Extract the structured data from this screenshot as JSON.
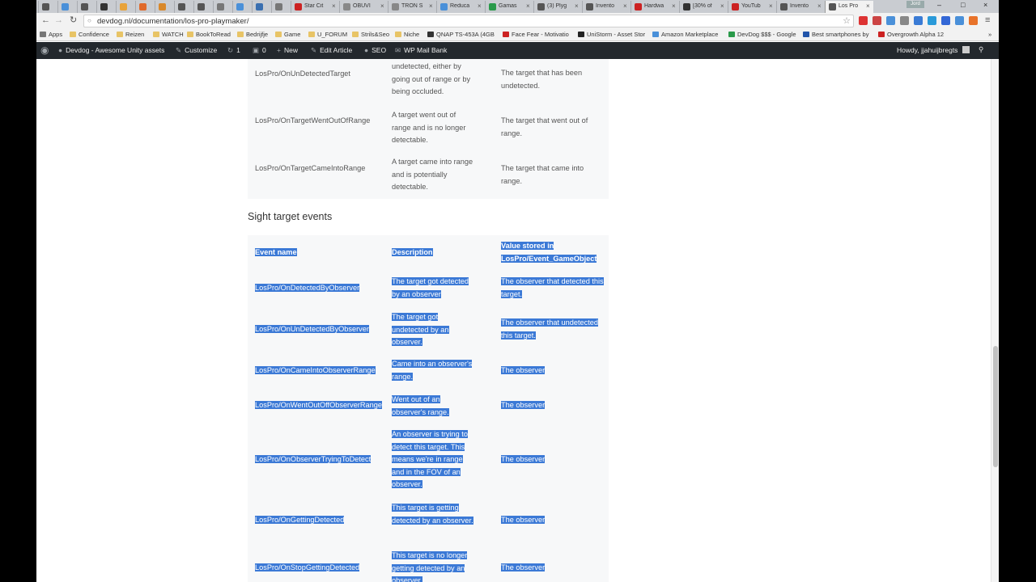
{
  "browser": {
    "tabs": [
      {
        "label": "",
        "color": "#555555"
      },
      {
        "label": "",
        "color": "#4a90d9"
      },
      {
        "label": "",
        "color": "#555555"
      },
      {
        "label": "",
        "color": "#333333"
      },
      {
        "label": "",
        "color": "#e8a33a"
      },
      {
        "label": "",
        "color": "#e06a2b"
      },
      {
        "label": "",
        "color": "#d9882a"
      },
      {
        "label": "",
        "color": "#555555"
      },
      {
        "label": "",
        "color": "#555555"
      },
      {
        "label": "",
        "color": "#777777"
      },
      {
        "label": "",
        "color": "#4a90d9"
      },
      {
        "label": "",
        "color": "#3a6fb0"
      },
      {
        "label": "",
        "color": "#777777"
      },
      {
        "label": "Star Cit",
        "color": "#cc2222"
      },
      {
        "label": "OBUVI",
        "color": "#888888"
      },
      {
        "label": "TRON S",
        "color": "#888888"
      },
      {
        "label": "Reduca",
        "color": "#4a90d9"
      },
      {
        "label": "Gamas",
        "color": "#2a9a4a"
      },
      {
        "label": "(3) Plyg",
        "color": "#555555"
      },
      {
        "label": "Invento",
        "color": "#555555"
      },
      {
        "label": "Hardwa",
        "color": "#cc2222"
      },
      {
        "label": "[30% of",
        "color": "#333333"
      },
      {
        "label": "YouTub",
        "color": "#cc2222"
      },
      {
        "label": "Invento",
        "color": "#555555"
      },
      {
        "label": "Los Pro",
        "color": "#555555"
      }
    ],
    "user_badge": "Jord",
    "url": "devdog.nl/documentation/los-pro-playmaker/",
    "bookmarks": [
      {
        "label": "Apps",
        "folder": false,
        "color": "#777777"
      },
      {
        "label": "Confidence",
        "folder": true
      },
      {
        "label": "Reizen",
        "folder": true
      },
      {
        "label": "WATCH",
        "folder": true
      },
      {
        "label": "BookToRead",
        "folder": true
      },
      {
        "label": "Bedrijfje",
        "folder": true
      },
      {
        "label": "Game",
        "folder": true
      },
      {
        "label": "U_FORUM",
        "folder": true
      },
      {
        "label": "Strils&Seo",
        "folder": true
      },
      {
        "label": "Niche",
        "folder": true
      },
      {
        "label": "QNAP TS-453A (4GB",
        "folder": false,
        "color": "#333333"
      },
      {
        "label": "Face Fear - Motivatio",
        "folder": false,
        "color": "#cc2222"
      },
      {
        "label": "UniStorm - Asset Stor",
        "folder": false,
        "color": "#222222"
      },
      {
        "label": "Amazon Marketplace",
        "folder": false,
        "color": "#4a90d9"
      },
      {
        "label": "DevDog $$$ - Google",
        "folder": false,
        "color": "#2a9a4a"
      },
      {
        "label": "Best smartphones by",
        "folder": false,
        "color": "#2255aa"
      },
      {
        "label": "Overgrowth Alpha 12",
        "folder": false,
        "color": "#cc2222"
      }
    ]
  },
  "adminbar": {
    "site": "Devdog - Awesome Unity assets",
    "customize": "Customize",
    "updates": "1",
    "comments": "0",
    "new": "New",
    "edit": "Edit Article",
    "seo": "SEO",
    "mail": "WP Mail Bank",
    "howdy": "Howdy, jjahuijbregts"
  },
  "range_table": {
    "rows": [
      {
        "name": "LosPro/OnUnDetectedTarget",
        "desc": "undetected, either by going out of range or by being occluded.",
        "value": "The target that has been undetected."
      },
      {
        "name": "LosPro/OnTargetWentOutOfRange",
        "desc": "A target went out of range and is no longer detectable.",
        "value": "The target that went out of range."
      },
      {
        "name": "LosPro/OnTargetCameIntoRange",
        "desc": "A target came into range and is potentially detectable.",
        "value": "The target that came into range."
      }
    ]
  },
  "sight": {
    "heading": "Sight target events",
    "headers": {
      "name": "Event name",
      "desc": "Description",
      "value": "Value stored in LosPro/Event_GameObject"
    },
    "rows": [
      {
        "name": "LosPro/OnDetectedByObserver",
        "desc": "The target got detected by an observer",
        "value": "The observer that detected this target."
      },
      {
        "name": "LosPro/OnUnDetectedByObserver",
        "desc": "The target got undetected by an observer.",
        "value": "The observer that undetected this target."
      },
      {
        "name": "LosPro/OnCameIntoObserverRange",
        "desc": "Came into an observer's range.",
        "value": "The observer"
      },
      {
        "name": "LosPro/OnWentOutOffObserverRange",
        "desc": "Went out of an observer's range.",
        "value": "The observer"
      },
      {
        "name": "LosPro/OnObserverTryingToDetect",
        "desc": "An observer is trying to detect this target. This means we're in range and in the FOV of an observer.",
        "value": "The observer"
      },
      {
        "name": "LosPro/OnGettingDetected",
        "desc": "This target is getting detected by an observer.",
        "value": "The observer"
      },
      {
        "name": "LosPro/OnStopGettingDetected",
        "desc": "This target is no longer getting detected by an observer.",
        "value": "The observer"
      }
    ]
  },
  "colors": {
    "selection": "#3b79d6",
    "adminbar": "#23282d"
  }
}
